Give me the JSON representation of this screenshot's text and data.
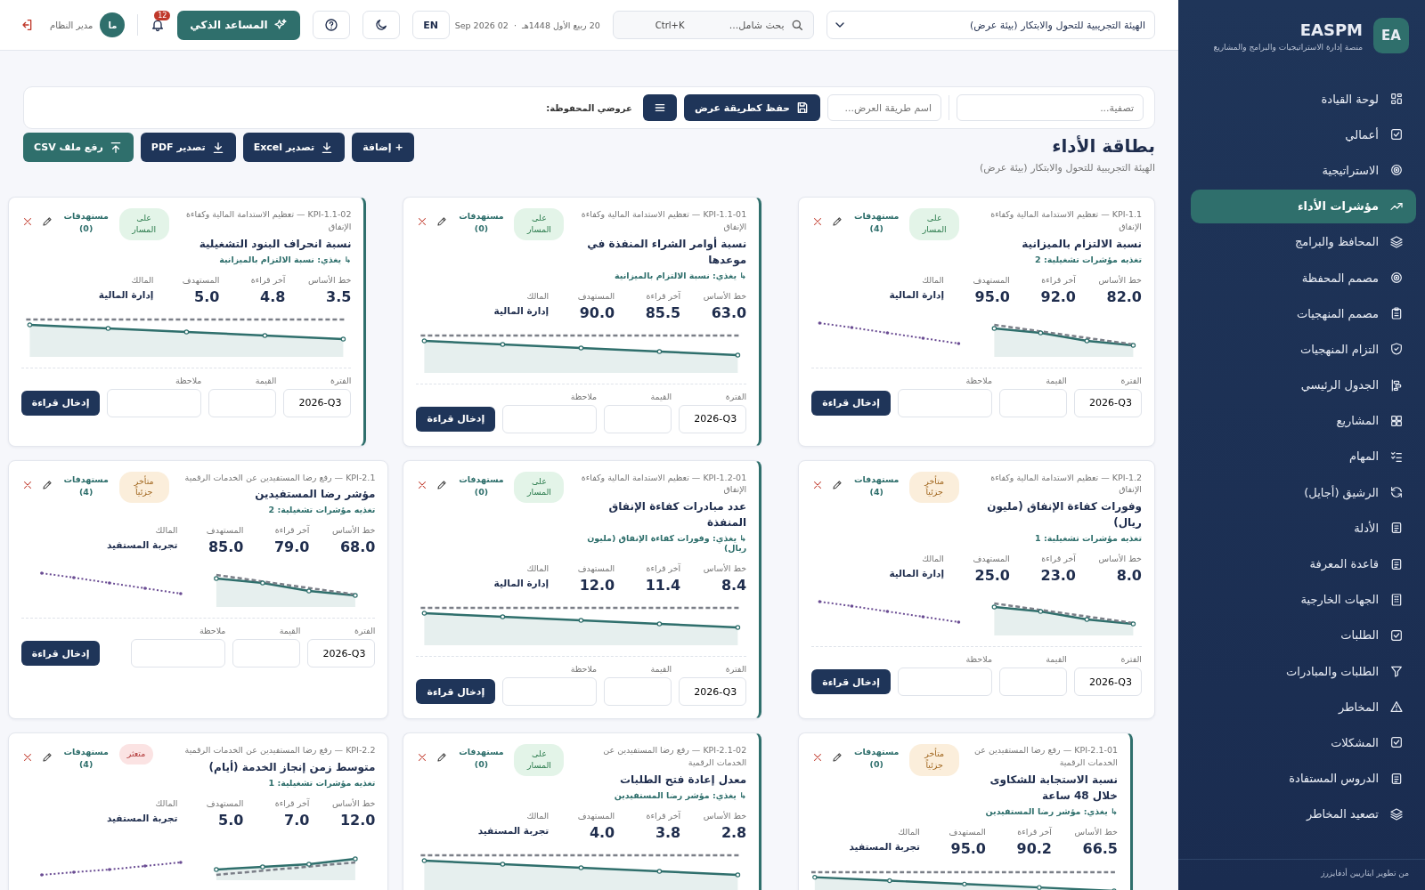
{
  "sidebar": {
    "logo": "EA",
    "brand": "EASPM",
    "tagline": "منصة إدارة الاستراتيجيات والبرامج والمشاريع",
    "items": [
      {
        "label": "لوحة القيادة",
        "selected": false
      },
      {
        "label": "أعمالي",
        "selected": false
      },
      {
        "label": "الاستراتيجية",
        "selected": false
      },
      {
        "label": "مؤشرات الأداء",
        "selected": true
      },
      {
        "label": "المحافظ والبرامج",
        "selected": false
      },
      {
        "label": "مصمم المحفظة",
        "selected": false
      },
      {
        "label": "مصمم المنهجيات",
        "selected": false
      },
      {
        "label": "التزام المنهجيات",
        "selected": false
      },
      {
        "label": "الجدول الرئيسي",
        "selected": false
      },
      {
        "label": "المشاريع",
        "selected": false
      },
      {
        "label": "المهام",
        "selected": false
      },
      {
        "label": "الرشيق (أجايل)",
        "selected": false
      },
      {
        "label": "الأدلة",
        "selected": false
      },
      {
        "label": "قاعدة المعرفة",
        "selected": false
      },
      {
        "label": "الجهات الخارجية",
        "selected": false
      },
      {
        "label": "الطلبات",
        "selected": false
      },
      {
        "label": "الطلبات والمبادرات",
        "selected": false
      },
      {
        "label": "المخاطر",
        "selected": false
      },
      {
        "label": "المشكلات",
        "selected": false
      },
      {
        "label": "الدروس المستفادة",
        "selected": false
      },
      {
        "label": "تصعيد المخاطر",
        "selected": false
      }
    ],
    "footer": "من تطوير ايثاريين أدفايزرز"
  },
  "topbar": {
    "organization": "الهيئة التجريبية للتحول والابتكار (بيئة عرض)",
    "search_placeholder": "بحث شامل...",
    "search_shortcut": "Ctrl+K",
    "hijri_date": "20 ربيع الأول 1448هـ",
    "separator": "·",
    "date": "02 Sep 2026",
    "language": "EN",
    "assistant": "المساعد الذكي",
    "notifications": "12",
    "avatar": "ما",
    "user": "مدير النظام"
  },
  "toolbar": {
    "filter_placeholder": "تصفية...",
    "view_name_placeholder": "اسم طريقة العرض...",
    "save_view": "حفظ كطريقة عرض",
    "saved_views": "عروضي المحفوظة:"
  },
  "page": {
    "title": "بطاقة الأداء",
    "subtitle": "الهيئة التجريبية للتحول والابتكار (بيئة عرض)",
    "actions": [
      "+ إضافة",
      "تصدير Excel",
      "تصدير PDF",
      "رفع ملف CSV"
    ]
  },
  "cards": [
    {
      "kind": "parent",
      "code_line": "KPI-1.1 — تعظيم الاستدامة المالية وكفاءة الإنفاق",
      "title": "نسبة الالتزام بالميزانية",
      "link": "تغذيه مؤشرات تشغيلية: 2",
      "status": {
        "kind": "on_track",
        "label": "على المسار"
      },
      "targets": "مستهدفات (4)",
      "stats": [
        {
          "label": "خط الأساس",
          "value": "82.0"
        },
        {
          "label": "آخر قراءة",
          "value": "92.0"
        },
        {
          "label": "المستهدف",
          "value": "95.0"
        }
      ],
      "owner": {
        "label": "المالك",
        "value": "إدارة المالية"
      },
      "chart": {
        "kind": "falling"
      },
      "entry": {
        "period_label": "الفترة",
        "period": "2026-Q3",
        "value_label": "القيمة",
        "note_label": "ملاحظة",
        "submit": "إدخال قراءة"
      }
    },
    {
      "kind": "child",
      "code_line": "KPI-1.1-01 — تعظيم الاستدامة المالية وكفاءة الإنفاق",
      "title": "نسبة أوامر الشراء المنفذة في موعدها",
      "link": "↳ يغذي: نسبة الالتزام بالميزانية",
      "status": {
        "kind": "on_track",
        "label": "على المسار"
      },
      "targets": "مستهدفات (0)",
      "stats": [
        {
          "label": "خط الأساس",
          "value": "63.0"
        },
        {
          "label": "آخر قراءة",
          "value": "85.5"
        },
        {
          "label": "المستهدف",
          "value": "90.0"
        }
      ],
      "owner": {
        "label": "المالك",
        "value": "إدارة المالية"
      },
      "chart": {
        "kind": "falling"
      },
      "entry": {
        "period_label": "الفترة",
        "period": "2026-Q3",
        "value_label": "القيمة",
        "note_label": "ملاحظة",
        "submit": "إدخال قراءة"
      }
    },
    {
      "kind": "child",
      "code_line": "KPI-1.1-02 — تعظيم الاستدامة المالية وكفاءة الإنفاق",
      "title": "نسبة انحراف البنود التشغيلية",
      "link": "↳ يغذي: نسبة الالتزام بالميزانية",
      "status": {
        "kind": "on_track",
        "label": "على المسار"
      },
      "targets": "مستهدفات (0)",
      "stats": [
        {
          "label": "خط الأساس",
          "value": "3.5"
        },
        {
          "label": "آخر قراءة",
          "value": "4.8"
        },
        {
          "label": "المستهدف",
          "value": "5.0"
        }
      ],
      "owner": {
        "label": "المالك",
        "value": "إدارة المالية"
      },
      "chart": {
        "kind": "falling"
      },
      "entry": {
        "period_label": "الفترة",
        "period": "2026-Q3",
        "value_label": "القيمة",
        "note_label": "ملاحظة",
        "submit": "إدخال قراءة"
      }
    },
    {
      "kind": "parent",
      "code_line": "KPI-1.2 — تعظيم الاستدامة المالية وكفاءة الإنفاق",
      "title": "وفورات كفاءة الإنفاق (مليون ريال)",
      "link": "تغذيه مؤشرات تشغيلية: 1",
      "status": {
        "kind": "partial",
        "label": "متأخر جزئياً"
      },
      "targets": "مستهدفات (4)",
      "stats": [
        {
          "label": "خط الأساس",
          "value": "8.0"
        },
        {
          "label": "آخر قراءة",
          "value": "23.0"
        },
        {
          "label": "المستهدف",
          "value": "25.0"
        }
      ],
      "owner": {
        "label": "المالك",
        "value": "إدارة المالية"
      },
      "chart": {
        "kind": "falling"
      },
      "entry": {
        "period_label": "الفترة",
        "period": "2026-Q3",
        "value_label": "القيمة",
        "note_label": "ملاحظة",
        "submit": "إدخال قراءة"
      }
    },
    {
      "kind": "child",
      "code_line": "KPI-1.2-01 — تعظيم الاستدامة المالية وكفاءة الإنفاق",
      "title": "عدد مبادرات كفاءة الإنفاق المنفذة",
      "link": "↳ يغذي: وفورات كفاءة الإنفاق (مليون ريال)",
      "status": {
        "kind": "on_track",
        "label": "على المسار"
      },
      "targets": "مستهدفات (0)",
      "stats": [
        {
          "label": "خط الأساس",
          "value": "8.4"
        },
        {
          "label": "آخر قراءة",
          "value": "11.4"
        },
        {
          "label": "المستهدف",
          "value": "12.0"
        }
      ],
      "owner": {
        "label": "المالك",
        "value": "إدارة المالية"
      },
      "chart": {
        "kind": "falling"
      },
      "entry": {
        "period_label": "الفترة",
        "period": "2026-Q3",
        "value_label": "القيمة",
        "note_label": "ملاحظة",
        "submit": "إدخال قراءة"
      }
    },
    {
      "kind": "parent",
      "code_line": "KPI-2.1 — رفع رضا المستفيدين عن الخدمات الرقمية",
      "title": "مؤشر رضا المستفيدين",
      "link": "تغذيه مؤشرات تشغيلية: 2",
      "status": {
        "kind": "partial",
        "label": "متأخر جزئياً"
      },
      "targets": "مستهدفات (4)",
      "stats": [
        {
          "label": "خط الأساس",
          "value": "68.0"
        },
        {
          "label": "آخر قراءة",
          "value": "79.0"
        },
        {
          "label": "المستهدف",
          "value": "85.0"
        }
      ],
      "owner": {
        "label": "المالك",
        "value": "تجربة المستفيد"
      },
      "chart": {
        "kind": "falling"
      },
      "entry": {
        "period_label": "الفترة",
        "period": "2026-Q3",
        "value_label": "القيمة",
        "note_label": "ملاحظة",
        "submit": "إدخال قراءة"
      }
    },
    {
      "kind": "child",
      "code_line": "KPI-2.1-01 — رفع رضا المستفيدين عن الخدمات الرقمية",
      "title": "نسبة الاستجابة للشكاوى خلال 48 ساعة",
      "link": "↳ يغذي: مؤشر رضا المستفيدين",
      "status": {
        "kind": "partial",
        "label": "متأخر جزئياً"
      },
      "targets": "مستهدفات (0)",
      "stats": [
        {
          "label": "خط الأساس",
          "value": "66.5"
        },
        {
          "label": "آخر قراءة",
          "value": "90.2"
        },
        {
          "label": "المستهدف",
          "value": "95.0"
        }
      ],
      "owner": {
        "label": "المالك",
        "value": "تجربة المستفيد"
      },
      "chart": {
        "kind": "falling"
      }
    },
    {
      "kind": "child",
      "code_line": "KPI-2.1-02 — رفع رضا المستفيدين عن الخدمات الرقمية",
      "title": "معدل إعادة فتح الطلبات",
      "link": "↳ يغذي: مؤشر رضا المستفيدين",
      "status": {
        "kind": "on_track",
        "label": "على المسار"
      },
      "targets": "مستهدفات (0)",
      "stats": [
        {
          "label": "خط الأساس",
          "value": "2.8"
        },
        {
          "label": "آخر قراءة",
          "value": "3.8"
        },
        {
          "label": "المستهدف",
          "value": "4.0"
        }
      ],
      "owner": {
        "label": "المالك",
        "value": "تجربة المستفيد"
      },
      "chart": {
        "kind": "falling"
      }
    },
    {
      "kind": "parent",
      "code_line": "KPI-2.2 — رفع رضا المستفيدين عن الخدمات الرقمية",
      "title": "متوسط زمن إنجاز الخدمة (أيام)",
      "link": "تغذيه مؤشرات تشغيلية: 1",
      "status": {
        "kind": "stalled",
        "label": "متعثر"
      },
      "targets": "مستهدفات (4)",
      "stats": [
        {
          "label": "خط الأساس",
          "value": "12.0"
        },
        {
          "label": "آخر قراءة",
          "value": "7.0"
        },
        {
          "label": "المستهدف",
          "value": "5.0"
        }
      ],
      "owner": {
        "label": "المالك",
        "value": "تجربة المستفيد"
      },
      "chart": {
        "kind": "rising"
      }
    }
  ]
}
